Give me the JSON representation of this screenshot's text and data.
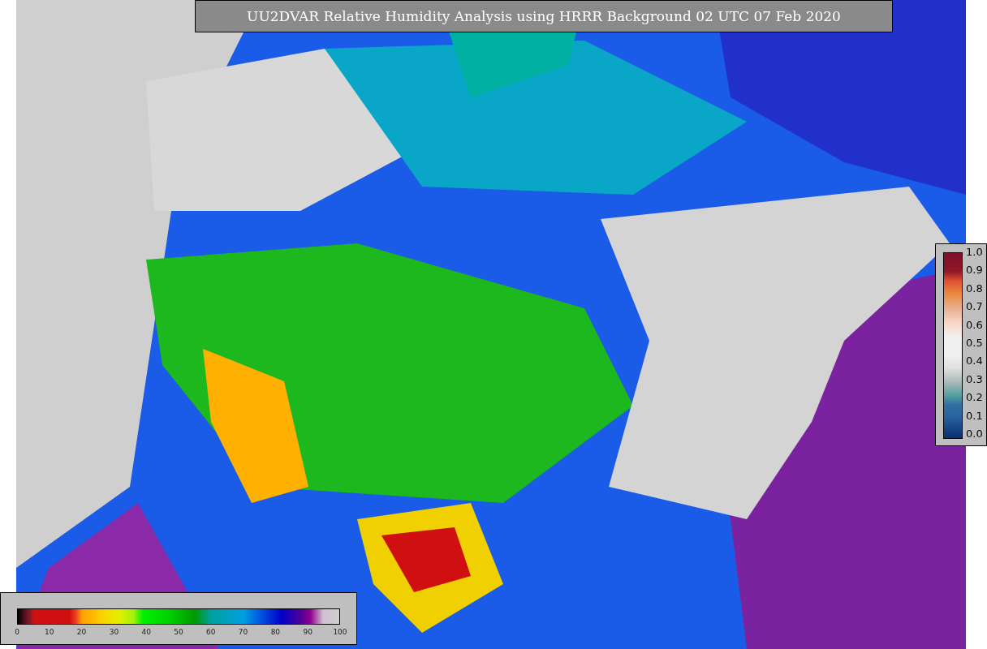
{
  "title": "UU2DVAR Relative Humidity Analysis using HRRR Background 02 UTC 07 Feb 2020",
  "humidity_colorbar": {
    "ticks": [
      "0",
      "10",
      "20",
      "30",
      "40",
      "50",
      "60",
      "70",
      "80",
      "90",
      "100"
    ]
  },
  "station_colorbar": {
    "ticks": [
      "1.0",
      "0.9",
      "0.8",
      "0.7",
      "0.6",
      "0.5",
      "0.4",
      "0.3",
      "0.2",
      "0.1",
      "0.0"
    ]
  }
}
